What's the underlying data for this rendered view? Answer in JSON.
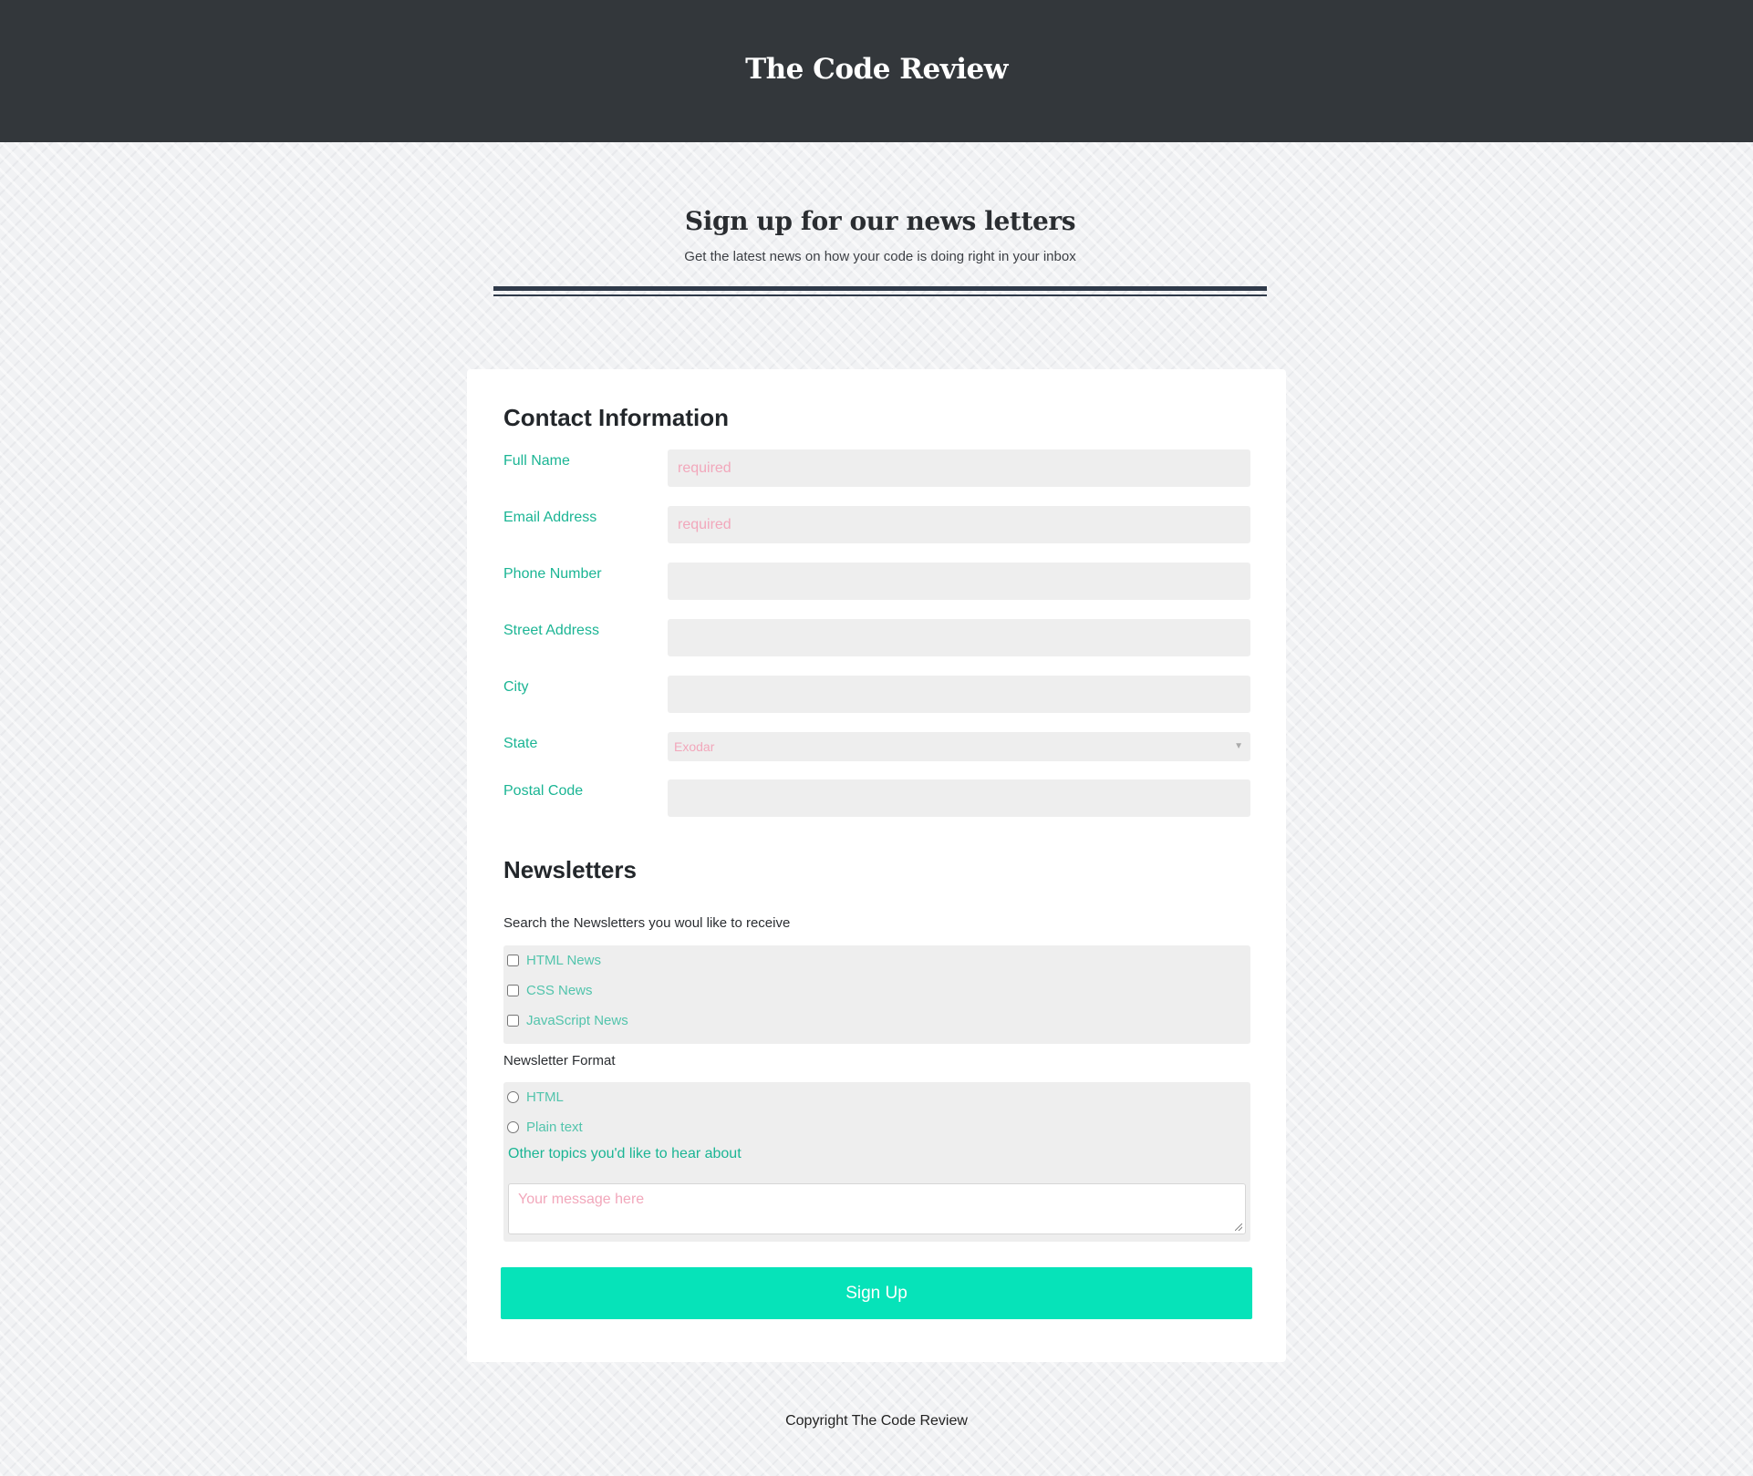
{
  "header": {
    "title": "The Code Review"
  },
  "intro": {
    "heading": "Sign up for our news letters",
    "subheading": "Get the latest news on how your code is doing right in your inbox"
  },
  "contact": {
    "title": "Contact Information",
    "fields": {
      "full_name": {
        "label": "Full Name",
        "placeholder": "required",
        "value": ""
      },
      "email": {
        "label": "Email Address",
        "placeholder": "required",
        "value": ""
      },
      "phone": {
        "label": "Phone Number",
        "placeholder": "",
        "value": ""
      },
      "street": {
        "label": "Street Address",
        "placeholder": "",
        "value": ""
      },
      "city": {
        "label": "City",
        "placeholder": "",
        "value": ""
      },
      "state": {
        "label": "State",
        "selected": "Exodar"
      },
      "postal": {
        "label": "Postal Code",
        "placeholder": "",
        "value": ""
      }
    }
  },
  "newsletters": {
    "title": "Newsletters",
    "search_label": "Search the Newsletters you woul like to receive",
    "options": [
      {
        "label": "HTML News",
        "checked": false
      },
      {
        "label": "CSS News",
        "checked": false
      },
      {
        "label": "JavaScript News",
        "checked": false
      }
    ],
    "format_label": "Newsletter Format",
    "formats": [
      {
        "label": "HTML",
        "checked": false
      },
      {
        "label": "Plain text",
        "checked": false
      }
    ],
    "topics_label": "Other topics you'd like to hear about",
    "message_placeholder": "Your message here"
  },
  "submit": {
    "label": "Sign Up"
  },
  "footer": {
    "copyright": "Copyright The Code Review"
  },
  "colors": {
    "header_bg": "#33373b",
    "accent": "#06e3b9",
    "label": "#1bb594",
    "placeholder": "#f2a7bb"
  }
}
